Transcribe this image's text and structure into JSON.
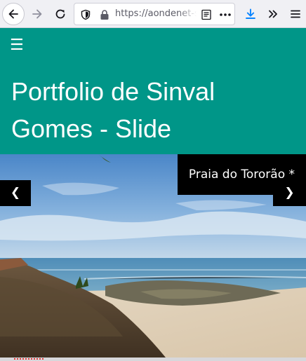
{
  "browser": {
    "url": "https://aondenet-sinval.herokuapp.com/slide",
    "icons": {
      "back": "back-arrow-icon",
      "forward": "forward-arrow-icon",
      "reload": "reload-icon",
      "tracking": "shield-icon",
      "secure": "lock-icon",
      "reader": "reader-view-icon",
      "page_actions": "more-horizontal-icon",
      "downloads": "download-icon",
      "overflow": "chevron-double-right-icon",
      "menu": "hamburger-menu-icon"
    },
    "accent_color": "#0a84ff"
  },
  "header": {
    "menu_glyph": "☰",
    "title": "Portfolio de Sinval Gomes - Slide",
    "background_color": "#009688"
  },
  "slideshow": {
    "caption": "Praia do Tororão *",
    "prev_glyph": "❮",
    "next_glyph": "❯",
    "image": "beach-coastline-photo"
  }
}
